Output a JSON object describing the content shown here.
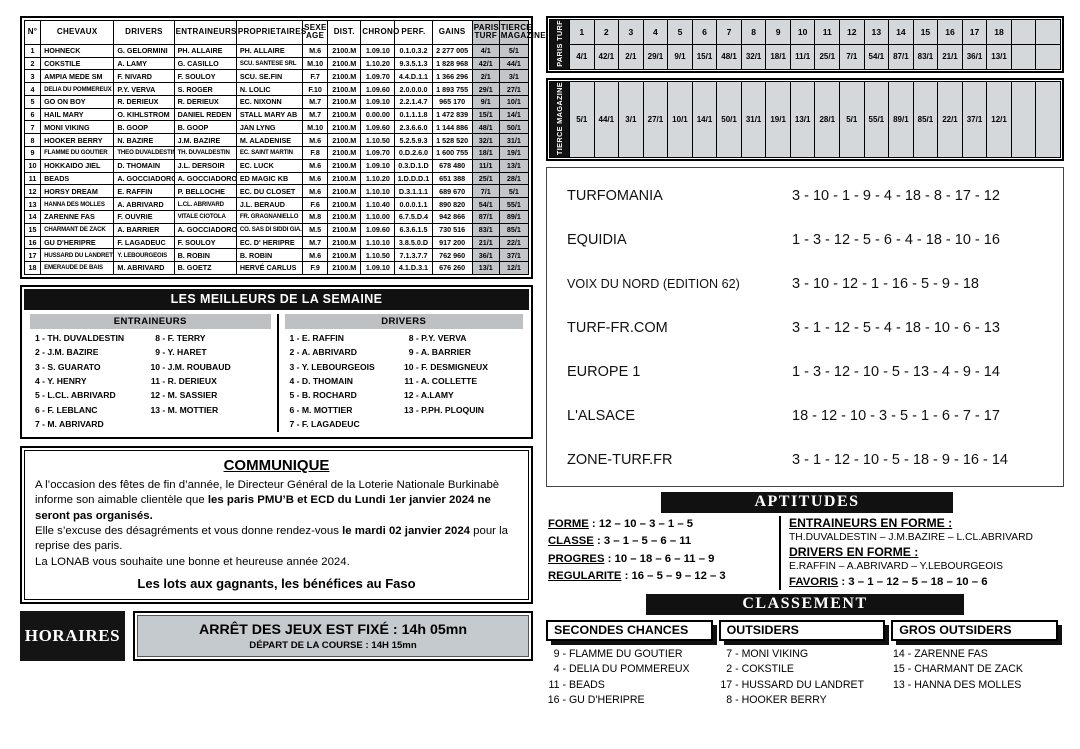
{
  "partants": {
    "headers": [
      "N°",
      "CHEVAUX",
      "DRIVERS",
      "ENTRAINEURS",
      "PROPRIETAIRES",
      "SEXE AGE",
      "DIST.",
      "CHRONO",
      "PERF.",
      "GAINS",
      "PARIS TURF",
      "TIERCE MAGAZINE"
    ],
    "rows": [
      {
        "n": "1",
        "cheval": "HOHNECK",
        "driver": "G. GELORMINI",
        "entraineur": "PH. ALLAIRE",
        "proprietaire": "PH. ALLAIRE",
        "sexe": "M.6",
        "dist": "2100.M",
        "chrono": "1.09.10",
        "perf": "0.1.0.3.2",
        "gains": "2 277 005",
        "pt": "4/1",
        "tm": "5/1"
      },
      {
        "n": "2",
        "cheval": "COKSTILE",
        "driver": "A. LAMY",
        "entraineur": "G. CASILLO",
        "proprietaire": "SCU. SANTESE SRL",
        "sexe": "M.10",
        "dist": "2100.M",
        "chrono": "1.10.20",
        "perf": "9.3.5.1.3",
        "gains": "1 828 968",
        "pt": "42/1",
        "tm": "44/1"
      },
      {
        "n": "3",
        "cheval": "AMPIA MEDE SM",
        "driver": "F. NIVARD",
        "entraineur": "F. SOULOY",
        "proprietaire": "SCU. SE.FIN",
        "sexe": "F.7",
        "dist": "2100.M",
        "chrono": "1.09.70",
        "perf": "4.4.D.1.1",
        "gains": "1 366 296",
        "pt": "2/1",
        "tm": "3/1"
      },
      {
        "n": "4",
        "cheval": "DELIA DU POMMEREUX",
        "driver": "P.Y. VERVA",
        "entraineur": "S. ROGER",
        "proprietaire": "N. LOLIC",
        "sexe": "F.10",
        "dist": "2100.M",
        "chrono": "1.09.60",
        "perf": "2.0.0.0.0",
        "gains": "1 893 755",
        "pt": "29/1",
        "tm": "27/1"
      },
      {
        "n": "5",
        "cheval": "GO ON BOY",
        "driver": "R. DERIEUX",
        "entraineur": "R. DERIEUX",
        "proprietaire": "EC. NIXONN",
        "sexe": "M.7",
        "dist": "2100.M",
        "chrono": "1.09.10",
        "perf": "2.2.1.4.7",
        "gains": "965 170",
        "pt": "9/1",
        "tm": "10/1"
      },
      {
        "n": "6",
        "cheval": "HAIL MARY",
        "driver": "O. KIHLSTROM",
        "entraineur": "DANIEL REDEN",
        "proprietaire": "STALL MARY AB",
        "sexe": "M.7",
        "dist": "2100.M",
        "chrono": "0.00.00",
        "perf": "0.1.1.1.8",
        "gains": "1 472 839",
        "pt": "15/1",
        "tm": "14/1"
      },
      {
        "n": "7",
        "cheval": "MONI VIKING",
        "driver": "B. GOOP",
        "entraineur": "B. GOOP",
        "proprietaire": "JAN LYNG",
        "sexe": "M.10",
        "dist": "2100.M",
        "chrono": "1.09.60",
        "perf": "2.3.6.6.0",
        "gains": "1 144 886",
        "pt": "48/1",
        "tm": "50/1"
      },
      {
        "n": "8",
        "cheval": "HOOKER BERRY",
        "driver": "N. BAZIRE",
        "entraineur": "J.M. BAZIRE",
        "proprietaire": "M. ALADENISE",
        "sexe": "M.6",
        "dist": "2100.M",
        "chrono": "1.10.50",
        "perf": "5.2.5.9.3",
        "gains": "1 528 520",
        "pt": "32/1",
        "tm": "31/1"
      },
      {
        "n": "9",
        "cheval": "FLAMME DU GOUTIER",
        "driver": "THEO DUVALDESTIN",
        "entraineur": "TH. DUVALDESTIN",
        "proprietaire": "EC. SAINT MARTIN",
        "sexe": "F.8",
        "dist": "2100.M",
        "chrono": "1.09.70",
        "perf": "0.D.2.6.0",
        "gains": "1 600 755",
        "pt": "18/1",
        "tm": "19/1"
      },
      {
        "n": "10",
        "cheval": "HOKKAIDO JIEL",
        "driver": "D. THOMAIN",
        "entraineur": "J.L. DERSOIR",
        "proprietaire": "EC. LUCK",
        "sexe": "M.6",
        "dist": "2100.M",
        "chrono": "1.09.10",
        "perf": "0.3.D.1.D",
        "gains": "678 480",
        "pt": "11/1",
        "tm": "13/1"
      },
      {
        "n": "11",
        "cheval": "BEADS",
        "driver": "A. GOCCIADORO",
        "entraineur": "A. GOCCIADORO",
        "proprietaire": "ED MAGIC KB",
        "sexe": "M.6",
        "dist": "2100.M",
        "chrono": "1.10.20",
        "perf": "1.D.D.D.1",
        "gains": "651 388",
        "pt": "25/1",
        "tm": "28/1"
      },
      {
        "n": "12",
        "cheval": "HORSY DREAM",
        "driver": "E. RAFFIN",
        "entraineur": "P. BELLOCHE",
        "proprietaire": "EC. DU CLOSET",
        "sexe": "M.6",
        "dist": "2100.M",
        "chrono": "1.10.10",
        "perf": "D.3.1.1.1",
        "gains": "689 670",
        "pt": "7/1",
        "tm": "5/1"
      },
      {
        "n": "13",
        "cheval": "HANNA DES MOLLES",
        "driver": "A. ABRIVARD",
        "entraineur": "L.CL. ABRIVARD",
        "proprietaire": "J.L. BERAUD",
        "sexe": "F.6",
        "dist": "2100.M",
        "chrono": "1.10.40",
        "perf": "0.0.0.1.1",
        "gains": "890 820",
        "pt": "54/1",
        "tm": "55/1"
      },
      {
        "n": "14",
        "cheval": "ZARENNE FAS",
        "driver": "F. OUVRIE",
        "entraineur": "VITALE CIOTOLA",
        "proprietaire": "FR. GRAGNANIELLO",
        "sexe": "M.8",
        "dist": "2100.M",
        "chrono": "1.10.00",
        "perf": "6.7.5.D.4",
        "gains": "942 866",
        "pt": "87/1",
        "tm": "89/1"
      },
      {
        "n": "15",
        "cheval": "CHARMANT DE ZACK",
        "driver": "A. BARRIER",
        "entraineur": "A. GOCCIADORO",
        "proprietaire": "CO. SAS DI SIDDI GIA.",
        "sexe": "M.5",
        "dist": "2100.M",
        "chrono": "1.09.60",
        "perf": "6.3.6.1.5",
        "gains": "730 516",
        "pt": "83/1",
        "tm": "85/1"
      },
      {
        "n": "16",
        "cheval": "GU D'HERIPRE",
        "driver": "F. LAGADEUC",
        "entraineur": "F. SOULOY",
        "proprietaire": "EC. D' HERIPRE",
        "sexe": "M.7",
        "dist": "2100.M",
        "chrono": "1.10.10",
        "perf": "3.8.5.0.D",
        "gains": "917 200",
        "pt": "21/1",
        "tm": "22/1"
      },
      {
        "n": "17",
        "cheval": "HUSSARD DU LANDRET",
        "driver": "Y. LEBOURGEOIS",
        "entraineur": "B. ROBIN",
        "proprietaire": "B. ROBIN",
        "sexe": "M.6",
        "dist": "2100.M",
        "chrono": "1.10.50",
        "perf": "7.1.3.7.7",
        "gains": "762 960",
        "pt": "36/1",
        "tm": "37/1"
      },
      {
        "n": "18",
        "cheval": "EMERAUDE DE BAIS",
        "driver": "M. ABRIVARD",
        "entraineur": "B. GOETZ",
        "proprietaire": "HERVÉ CARLUS",
        "sexe": "F.9",
        "dist": "2100.M",
        "chrono": "1.09.10",
        "perf": "4.1.D.3.1",
        "gains": "676 260",
        "pt": "13/1",
        "tm": "12/1"
      }
    ]
  },
  "best_week": {
    "title": "LES MEILLEURS DE LA SEMAINE",
    "entraineurs_title": "ENTRAINEURS",
    "drivers_title": "DRIVERS",
    "entraineurs_left": [
      {
        "num": "1 -",
        "name": "TH. DUVALDESTIN"
      },
      {
        "num": "2 -",
        "name": "J.M. BAZIRE"
      },
      {
        "num": "3 -",
        "name": "S. GUARATO"
      },
      {
        "num": "4 -",
        "name": "Y. HENRY"
      },
      {
        "num": "5 -",
        "name": "L.CL. ABRIVARD"
      },
      {
        "num": "6 -",
        "name": "F. LEBLANC"
      },
      {
        "num": "7 -",
        "name": "M. ABRIVARD"
      }
    ],
    "entraineurs_right": [
      {
        "num": "8 -",
        "name": "F. TERRY"
      },
      {
        "num": "9 -",
        "name": "Y. HARET"
      },
      {
        "num": "10 -",
        "name": "J.M. ROUBAUD"
      },
      {
        "num": "11 -",
        "name": "R. DERIEUX"
      },
      {
        "num": "12 -",
        "name": "M. SASSIER"
      },
      {
        "num": "13 -",
        "name": "M. MOTTIER"
      }
    ],
    "drivers_left": [
      {
        "num": "1 -",
        "name": "E. RAFFIN"
      },
      {
        "num": "2 -",
        "name": "A. ABRIVARD"
      },
      {
        "num": "3 -",
        "name": "Y. LEBOURGEOIS"
      },
      {
        "num": "4 -",
        "name": "D. THOMAIN"
      },
      {
        "num": "5 -",
        "name": "B. ROCHARD"
      },
      {
        "num": "6 -",
        "name": "M. MOTTIER"
      },
      {
        "num": "7 -",
        "name": "F. LAGADEUC"
      }
    ],
    "drivers_right": [
      {
        "num": "8 -",
        "name": "P.Y. VERVA"
      },
      {
        "num": "9 -",
        "name": "A. BARRIER"
      },
      {
        "num": "10 -",
        "name": "F. DESMIGNEUX"
      },
      {
        "num": "11 -",
        "name": "A. COLLETTE"
      },
      {
        "num": "12 -",
        "name": "A.LAMY"
      },
      {
        "num": "13 -",
        "name": "P.PH. PLOQUIN"
      }
    ]
  },
  "communique": {
    "title": "COMMUNIQUE",
    "p1_a": "A l’occasion des fêtes de fin d’année, le Directeur Général de la Loterie Nationale Burkinabè informe son aimable clientèle que ",
    "p1_b": "les paris PMU’B et ECD du Lundi 1er janvier 2024 ne seront pas organisés.",
    "p2_a": "Elle s’excuse des désagréments et vous donne rendez-vous ",
    "p2_b": "le mardi 02 janvier 2024",
    "p2_c": " pour la reprise des paris.",
    "p3": "La LONAB vous souhaite une bonne et heureuse année 2024.",
    "slogan": "Les lots aux gagnants, les bénéfices au Faso"
  },
  "horaires": {
    "label": "HORAIRES",
    "line1": "ARRÊT DES JEUX EST FIXÉ : 14h 05mn",
    "line2": "DÉPART DE LA COURSE : 14H 15mn"
  },
  "odds": {
    "paris_turf_label": "PARIS TURF",
    "tierce_label": "TIERCE MAGAZINE",
    "numbers": [
      "1",
      "2",
      "3",
      "4",
      "5",
      "6",
      "7",
      "8",
      "9",
      "10",
      "11",
      "12",
      "13",
      "14",
      "15",
      "16",
      "17",
      "18"
    ],
    "paris_turf": [
      "4/1",
      "42/1",
      "2/1",
      "29/1",
      "9/1",
      "15/1",
      "48/1",
      "32/1",
      "18/1",
      "11/1",
      "25/1",
      "7/1",
      "54/1",
      "87/1",
      "83/1",
      "21/1",
      "36/1",
      "13/1"
    ],
    "tierce_magazine": [
      "5/1",
      "44/1",
      "3/1",
      "27/1",
      "10/1",
      "14/1",
      "50/1",
      "31/1",
      "19/1",
      "13/1",
      "28/1",
      "5/1",
      "55/1",
      "89/1",
      "85/1",
      "22/1",
      "37/1",
      "12/1"
    ]
  },
  "pronostics": [
    {
      "source": "TURFOMANIA",
      "picks": "3 - 10 - 1 - 9 - 4 - 18 - 8 - 17 - 12",
      "small": false
    },
    {
      "source": "EQUIDIA",
      "picks": "1 - 3 - 12 - 5 - 6 - 4 - 18 - 10 - 16",
      "small": false
    },
    {
      "source": "VOIX DU NORD (EDITION 62)",
      "picks": "3 - 10 - 12 - 1 - 16 - 5 - 9 - 18",
      "small": true
    },
    {
      "source": "TURF-FR.COM",
      "picks": "3 - 1 - 12 - 5 - 4 - 18 - 10 - 6 - 13",
      "small": false
    },
    {
      "source": "EUROPE 1",
      "picks": "1 - 3 - 12 - 10 - 5 - 13 - 4 - 9 - 14",
      "small": false
    },
    {
      "source": "L'ALSACE",
      "picks": "18 - 12 - 10 - 3 - 5 - 1 - 6 - 7 - 17",
      "small": false
    },
    {
      "source": "ZONE-TURF.FR",
      "picks": "3 - 1 - 12 - 10 - 5 - 18 - 9 - 16 - 14",
      "small": false
    }
  ],
  "aptitudes": {
    "banner": "APTITUDES",
    "left": [
      {
        "label": "FORME",
        "value": "12 – 10 – 3 – 1 – 5"
      },
      {
        "label": "CLASSE",
        "value": "3 – 1 – 5 – 6 – 11"
      },
      {
        "label": "PROGRES",
        "value": "10 – 18 – 6 – 11 – 9"
      },
      {
        "label": "REGULARITE",
        "value": "16 – 5 – 9 – 12 – 3"
      }
    ],
    "entraineurs_head": "ENTRAINEURS EN FORME :",
    "entraineurs_names": "TH.DUVALDESTIN – J.M.BAZIRE – L.CL.ABRIVARD",
    "drivers_head": "DRIVERS EN FORME :",
    "drivers_names": "E.RAFFIN – A.ABRIVARD – Y.LEBOURGEOIS",
    "favoris_label": "FAVORIS",
    "favoris_value": " : 3 – 1 – 12 – 5 – 18 – 10 – 6"
  },
  "classement": {
    "banner": "CLASSEMENT",
    "columns": [
      {
        "title": "SECONDES CHANCES",
        "items": [
          {
            "num": "9 -",
            "name": "FLAMME DU GOUTIER"
          },
          {
            "num": "4 -",
            "name": "DELIA DU POMMEREUX"
          },
          {
            "num": "11 -",
            "name": "BEADS"
          },
          {
            "num": "16 -",
            "name": "GU D'HERIPRE"
          }
        ]
      },
      {
        "title": "OUTSIDERS",
        "items": [
          {
            "num": "7 -",
            "name": "MONI VIKING"
          },
          {
            "num": "2 -",
            "name": "COKSTILE"
          },
          {
            "num": "17 -",
            "name": "HUSSARD DU LANDRET"
          },
          {
            "num": "8 -",
            "name": "HOOKER BERRY"
          }
        ]
      },
      {
        "title": "GROS OUTSIDERS",
        "items": [
          {
            "num": "14 -",
            "name": "ZARENNE FAS"
          },
          {
            "num": "15 -",
            "name": "CHARMANT DE ZACK"
          },
          {
            "num": "13 -",
            "name": "HANNA DES MOLLES"
          }
        ]
      }
    ]
  },
  "colors": {
    "banner_black": "#111111",
    "header_shade": "#c2c6c9",
    "odds_shade": "#d4d8db"
  }
}
